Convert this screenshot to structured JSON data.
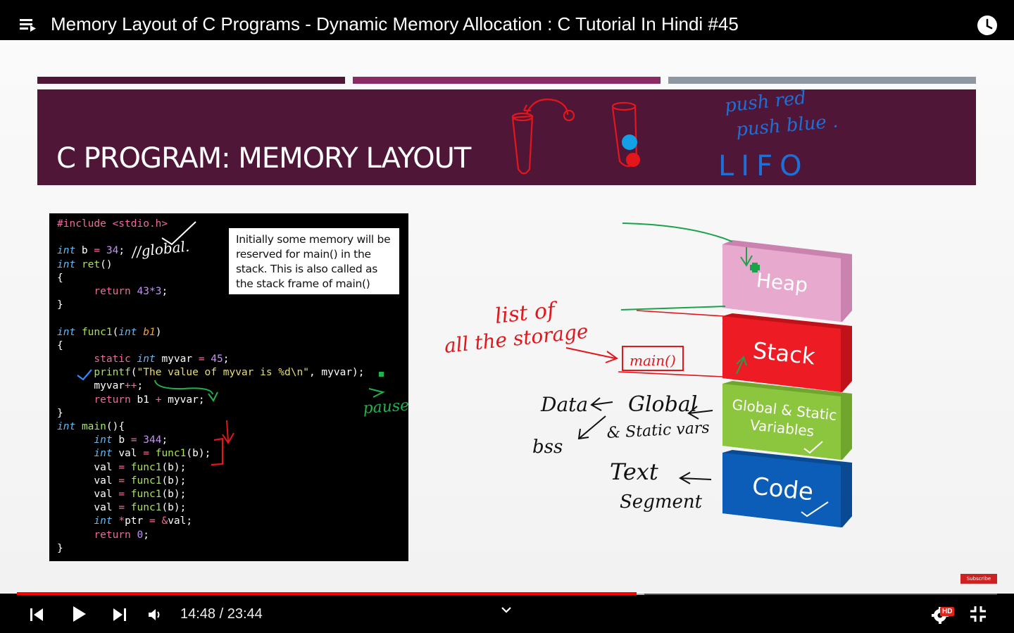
{
  "player": {
    "title": "Memory Layout of C Programs - Dynamic Memory Allocation : C Tutorial In Hindi #45",
    "time_display": "14:48 / 23:44",
    "progress_fraction": 0.632,
    "buffered_fraction": 0.64,
    "hd_badge": "HD",
    "subscribe_label": "Subscribe",
    "icons": [
      "playlist-icon",
      "watch-later-icon",
      "skip-previous-icon",
      "play-icon",
      "skip-next-icon",
      "volume-icon",
      "chevron-down-icon",
      "settings-icon",
      "exit-fullscreen-icon"
    ]
  },
  "slide": {
    "title": "C PROGRAM: MEMORY LAYOUT",
    "bar_colors": [
      "#4f1637",
      "#8a2b66",
      "#8f97a3"
    ],
    "note": "Initially some memory will be reserved for main() in the stack. This is also called as the stack frame of main()",
    "code": {
      "include": "#include <stdio.h>",
      "b_init_value": "34",
      "ret_return": "43*3",
      "myvar_value": "45",
      "format_string": "\"The value of myvar is %d\\n\"",
      "main_b_value": "344",
      "main_return": "0"
    },
    "memory_blocks": [
      {
        "label": "Heap",
        "color": "#e8a9cf"
      },
      {
        "label": "Stack",
        "color": "#ed1c24"
      },
      {
        "label": "Global & Static\nVariables",
        "color": "#8cc63f"
      },
      {
        "label": "Code",
        "color": "#0b5db8"
      }
    ]
  },
  "handwriting": {
    "push_red": "push red",
    "push_blue": "push blue .",
    "lifo": "LIFO",
    "global_comment": "//global.",
    "pause": "pause",
    "list_of": "list of",
    "all_the_storage": "all the storage",
    "main_box": "main()",
    "data": "Data",
    "bss": "bss",
    "global": "Global",
    "static_vars": "& Static vars",
    "text": "Text",
    "segment": "Segment"
  }
}
